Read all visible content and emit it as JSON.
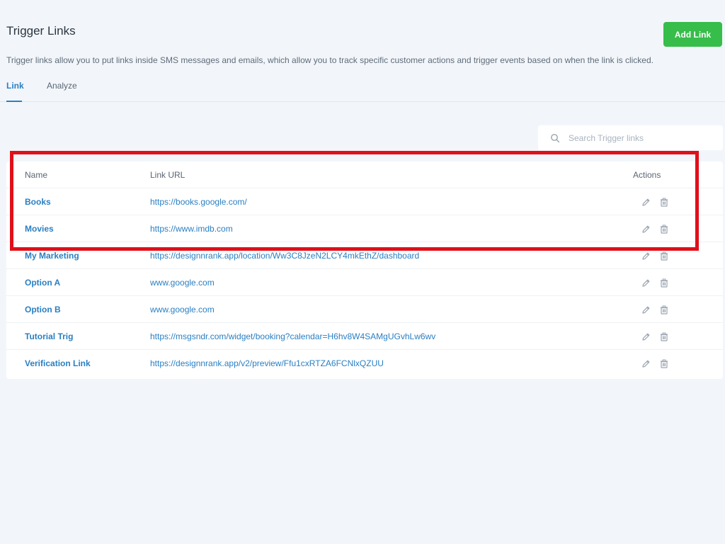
{
  "header": {
    "title": "Trigger Links",
    "add_button_label": "Add Link",
    "description": "Trigger links allow you to put links inside SMS messages and emails, which allow you to track specific customer actions and trigger events based on when the link is clicked."
  },
  "tabs": [
    {
      "label": "Link",
      "active": true
    },
    {
      "label": "Analyze",
      "active": false
    }
  ],
  "search": {
    "placeholder": "Search Trigger links",
    "value": "",
    "icon": "search-icon"
  },
  "table": {
    "columns": {
      "name": "Name",
      "url": "Link URL",
      "actions": "Actions"
    },
    "rows": [
      {
        "name": "Books",
        "url": "https://books.google.com/"
      },
      {
        "name": "Movies",
        "url": "https://www.imdb.com"
      },
      {
        "name": "My Marketing",
        "url": "https://designnrank.app/location/Ww3C8JzeN2LCY4mkEthZ/dashboard"
      },
      {
        "name": "Option A",
        "url": "www.google.com"
      },
      {
        "name": "Option B",
        "url": "www.google.com"
      },
      {
        "name": "Tutorial Trig",
        "url": "https://msgsndr.com/widget/booking?calendar=H6hv8W4SAMgUGvhLw6wv"
      },
      {
        "name": "Verification Link",
        "url": "https://designnrank.app/v2/preview/Ffu1cxRTZA6FCNlxQZUU"
      }
    ],
    "action_icons": [
      "pencil-icon",
      "trash-icon"
    ]
  },
  "colors": {
    "accent": "#2a7fc2",
    "add_button": "#37bd4a",
    "highlight": "#e0101a",
    "background": "#f2f6fa"
  }
}
